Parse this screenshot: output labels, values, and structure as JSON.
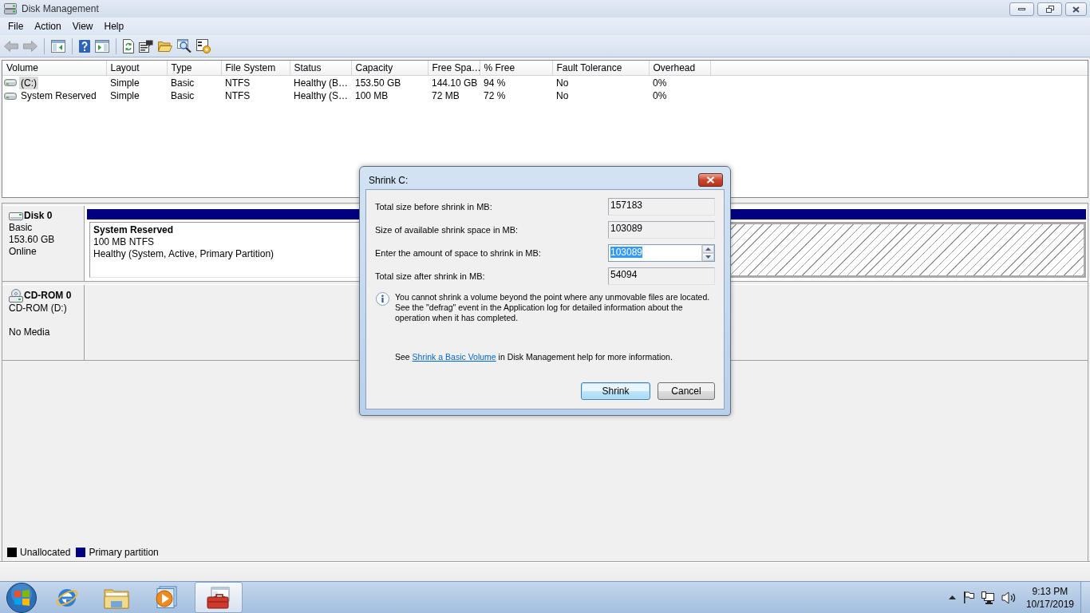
{
  "window": {
    "title": "Disk Management"
  },
  "menu": [
    "File",
    "Action",
    "View",
    "Help"
  ],
  "toolbar": {
    "groups": [
      {
        "buttons": [
          {
            "kind": "back",
            "disabled": true
          },
          {
            "kind": "forward",
            "disabled": true
          }
        ]
      },
      {
        "buttons": [
          {
            "kind": "console_tree",
            "disabled": false
          }
        ]
      },
      {
        "buttons": [
          {
            "kind": "help",
            "disabled": false
          },
          {
            "kind": "action_pane",
            "disabled": false
          }
        ]
      },
      {
        "buttons": [
          {
            "kind": "refresh",
            "disabled": false
          },
          {
            "kind": "properties",
            "disabled": false
          },
          {
            "kind": "open",
            "disabled": false
          },
          {
            "kind": "find",
            "disabled": false
          },
          {
            "kind": "settings",
            "disabled": false
          }
        ]
      }
    ]
  },
  "volume_table": {
    "columns": [
      "Volume",
      "Layout",
      "Type",
      "File System",
      "Status",
      "Capacity",
      "Free Spa…",
      "% Free",
      "Fault Tolerance",
      "Overhead"
    ],
    "rows": [
      {
        "selected": true,
        "cells": [
          "(C:)",
          "Simple",
          "Basic",
          "NTFS",
          "Healthy (B…",
          "153.50 GB",
          "144.10 GB",
          "94 %",
          "No",
          "0%"
        ]
      },
      {
        "selected": false,
        "cells": [
          "System Reserved",
          "Simple",
          "Basic",
          "NTFS",
          "Healthy (S…",
          "100 MB",
          "72 MB",
          "72 %",
          "No",
          "0%"
        ]
      }
    ]
  },
  "disks": [
    {
      "kind": "disk",
      "name": "Disk 0",
      "type": "Basic",
      "size": "153.60 GB",
      "status": "Online",
      "partitions": [
        {
          "kind": "primary",
          "selected": false,
          "name": "System Reserved",
          "size": "100 MB NTFS",
          "status": "Healthy (System, Active, Primary Partition)"
        },
        {
          "kind": "primary",
          "selected": true
        }
      ]
    },
    {
      "kind": "cdrom",
      "name": "CD-ROM 0",
      "type": "CD-ROM (D:)",
      "status": "No Media"
    }
  ],
  "legend": [
    {
      "label": "Unallocated",
      "color": "#000000"
    },
    {
      "label": "Primary partition",
      "color": "#000080"
    }
  ],
  "dialog": {
    "title": "Shrink C:",
    "fields": [
      {
        "kind": "readonly",
        "label": "Total size before shrink in MB:",
        "value": "157183",
        "highlighted": false
      },
      {
        "kind": "readonly",
        "label": "Size of available shrink space in MB:",
        "value": "103089",
        "highlighted": false
      },
      {
        "kind": "spin",
        "label": "Enter the amount of space to shrink in MB:",
        "value": "103089",
        "highlighted": true
      },
      {
        "kind": "readonly",
        "label": "Total size after shrink in MB:",
        "value": "54094",
        "highlighted": false
      }
    ],
    "note": "You cannot shrink a volume beyond the point where any unmovable files are located. See the \"defrag\" event in the Application log for detailed information about the operation when it has completed.",
    "help": {
      "before": "See",
      "link": "Shrink a Basic Volume",
      "after": "in Disk Management help for more information."
    },
    "buttons": [
      {
        "kind": "confirm",
        "label": "Shrink",
        "default": true
      },
      {
        "kind": "cancel",
        "label": "Cancel",
        "default": false
      }
    ]
  },
  "taskbar": {
    "apps": [
      {
        "kind": "browser",
        "selected": false
      },
      {
        "kind": "folder",
        "selected": false
      },
      {
        "kind": "media",
        "selected": false
      },
      {
        "kind": "toolbox",
        "selected": true
      }
    ],
    "clock": {
      "time": "9:13 PM",
      "date": "10/17/2019"
    }
  }
}
